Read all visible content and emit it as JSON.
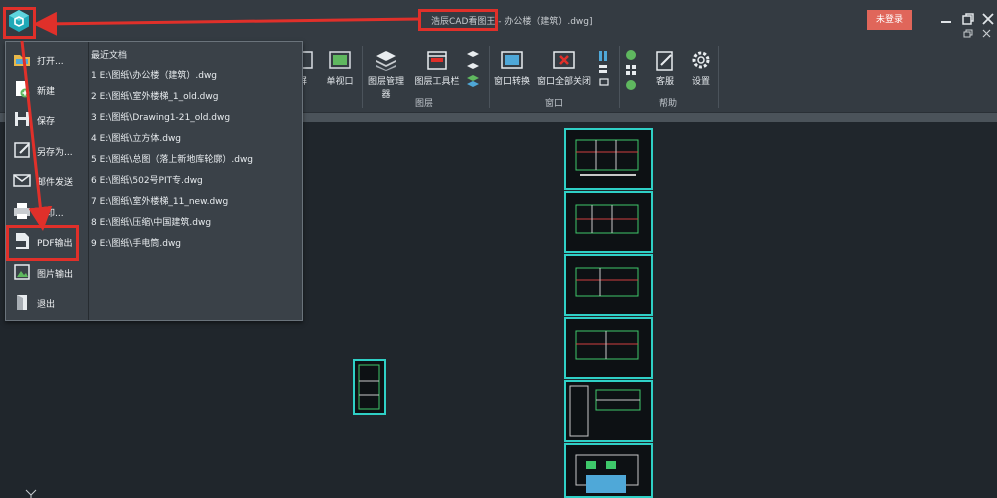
{
  "title_bar": {
    "app_name": "浩辰CAD看图王",
    "doc_name": "- 办公楼（建筑）.dwg]",
    "login_label": "未登录"
  },
  "ribbon": {
    "buttons": {
      "fullscreen": "屏",
      "single_viewport": "单视口",
      "layer_manager": "图层管理器",
      "layer_toolbar": "图层工具栏",
      "window_switch": "窗口转换",
      "close_all_windows": "窗口全部关闭",
      "customer_service": "客服",
      "settings": "设置"
    },
    "groups": {
      "layers": "图层",
      "window": "窗口",
      "help": "帮助"
    }
  },
  "app_menu": {
    "items": [
      {
        "label": "打开...",
        "icon": "folder-open-icon"
      },
      {
        "label": "新建",
        "icon": "new-file-icon"
      },
      {
        "label": "保存",
        "icon": "save-icon"
      },
      {
        "label": "另存为...",
        "icon": "save-as-icon"
      },
      {
        "label": "邮件发送",
        "icon": "mail-icon"
      },
      {
        "label": "打印...",
        "icon": "printer-icon"
      },
      {
        "label": "PDF输出",
        "icon": "pdf-icon"
      },
      {
        "label": "图片输出",
        "icon": "image-icon"
      },
      {
        "label": "退出",
        "icon": "exit-icon"
      }
    ],
    "recent_title": "最近文档",
    "recent_files": [
      "1 E:\\图纸\\办公楼（建筑）.dwg",
      "2 E:\\图纸\\室外楼梯_1_old.dwg",
      "3 E:\\图纸\\Drawing1-21_old.dwg",
      "4 E:\\图纸\\立方体.dwg",
      "5 E:\\图纸\\总图（落上新地库轮廓）.dwg",
      "6 E:\\图纸\\502号PIT专.dwg",
      "7 E:\\图纸\\室外楼梯_11_new.dwg",
      "8 E:\\图纸\\压缩\\中国建筑.dwg",
      "9 E:\\图纸\\手电筒.dwg"
    ]
  },
  "colors": {
    "highlight": "#e0302a",
    "login": "#e0665a",
    "sheet_border": "#2fd0c6",
    "background": "#20262c"
  }
}
